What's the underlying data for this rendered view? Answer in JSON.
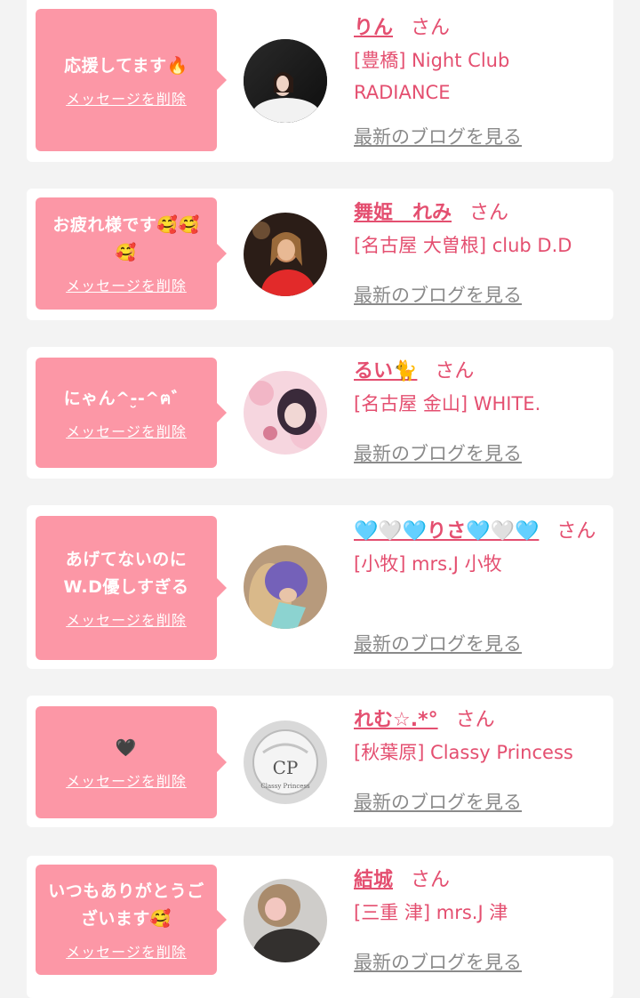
{
  "delete_label": "メッセージを削除",
  "blog_label": "最新のブログを見る",
  "san_label": "さん",
  "cards": [
    {
      "message": "応援してます🔥",
      "name": "りん",
      "shop": "[豊橋] Night Club RADIANCE",
      "avatar_icon": "woman-portrait-dark"
    },
    {
      "message": "お疲れ様です🥰🥰🥰",
      "name": "舞姫　れみ",
      "shop": "[名古屋 大曽根] club D.D",
      "avatar_icon": "woman-red-dress"
    },
    {
      "message": "にゃん^-̮-^ฅ゛",
      "name": "るい🐈",
      "shop": "[名古屋 金山] WHITE.",
      "avatar_icon": "woman-pink-flowers"
    },
    {
      "message": "あげてないのにW.D優しすぎる",
      "name": "🩵🤍🩵りさ🩵🤍🩵",
      "shop": "[小牧] mrs.J 小牧",
      "avatar_icon": "woman-purple-blur"
    },
    {
      "message": "🖤",
      "name": "れむ☆.*°",
      "shop": "[秋葉原] Classy Princess",
      "avatar_icon": "classy-princess-logo",
      "logo_text": "Classy Princess"
    },
    {
      "message": "いつもありがとうございます🥰",
      "name": "結城",
      "shop": "[三重 津] mrs.J 津",
      "avatar_icon": "woman-fur-coat"
    }
  ],
  "colors": {
    "bubble": "#fc97a6",
    "accent": "#e44f70",
    "link_gray": "#8a8a8a"
  }
}
